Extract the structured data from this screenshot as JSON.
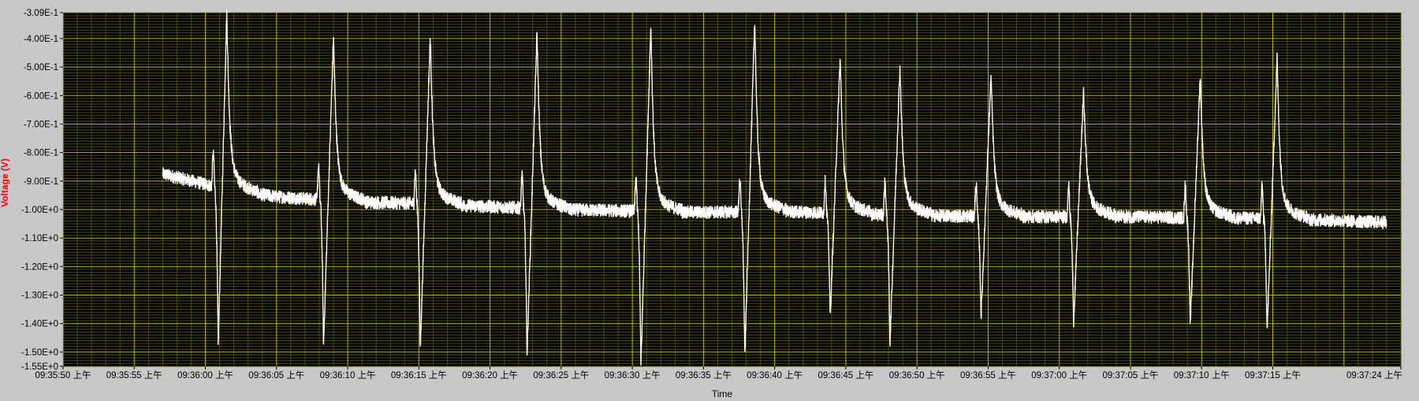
{
  "chart_data": {
    "type": "line",
    "title": "",
    "xlabel": "Time",
    "ylabel": "Voltage (V)",
    "y_scale": "linear",
    "ylim": [
      -1.55,
      -0.309
    ],
    "x_range": [
      "09:35:50",
      "09:37:24"
    ],
    "grid": true,
    "legend": "none",
    "colors": {
      "background": "#c8c8c8",
      "plot_background": "#000000",
      "grid_major": "#b8b800",
      "grid_minor": "#4a4a00",
      "trace": "#ffffff",
      "ylabel": "#ff0000",
      "tick_text": "#000000"
    },
    "y_ticks": [
      {
        "value": -0.309,
        "label": "-3.09E-1"
      },
      {
        "value": -0.4,
        "label": "-4.00E-1"
      },
      {
        "value": -0.5,
        "label": "-5.00E-1"
      },
      {
        "value": -0.6,
        "label": "-6.00E-1"
      },
      {
        "value": -0.7,
        "label": "-7.00E-1"
      },
      {
        "value": -0.8,
        "label": "-8.00E-1"
      },
      {
        "value": -0.9,
        "label": "-9.00E-1"
      },
      {
        "value": -1.0,
        "label": "-1.00E+0"
      },
      {
        "value": -1.1,
        "label": "-1.10E+0"
      },
      {
        "value": -1.2,
        "label": "-1.20E+0"
      },
      {
        "value": -1.3,
        "label": "-1.30E+0"
      },
      {
        "value": -1.4,
        "label": "-1.40E+0"
      },
      {
        "value": -1.5,
        "label": "-1.50E+0"
      },
      {
        "value": -1.55,
        "label": "-1.55E+0"
      }
    ],
    "x_ticks": [
      {
        "value": "09:35:50",
        "label": "09:35:50 上午"
      },
      {
        "value": "09:35:55",
        "label": "09:35:55 上午"
      },
      {
        "value": "09:36:00",
        "label": "09:36:00 上午"
      },
      {
        "value": "09:36:05",
        "label": "09:36:05 上午"
      },
      {
        "value": "09:36:10",
        "label": "09:36:10 上午"
      },
      {
        "value": "09:36:15",
        "label": "09:36:15 上午"
      },
      {
        "value": "09:36:20",
        "label": "09:36:20 上午"
      },
      {
        "value": "09:36:25",
        "label": "09:36:25 上午"
      },
      {
        "value": "09:36:30",
        "label": "09:36:30 上午"
      },
      {
        "value": "09:36:35",
        "label": "09:36:35 上午"
      },
      {
        "value": "09:36:40",
        "label": "09:36:40 上午"
      },
      {
        "value": "09:36:45",
        "label": "09:36:45 上午"
      },
      {
        "value": "09:36:50",
        "label": "09:36:50 上午"
      },
      {
        "value": "09:36:55",
        "label": "09:36:55 上午"
      },
      {
        "value": "09:37:00",
        "label": "09:37:00 上午"
      },
      {
        "value": "09:37:05",
        "label": "09:37:05 上午"
      },
      {
        "value": "09:37:10",
        "label": "09:37:10 上午"
      },
      {
        "value": "09:37:15",
        "label": "09:37:15 上午"
      },
      {
        "value": "09:37:24",
        "label": "09:37:24 上午"
      }
    ],
    "series": [
      {
        "start": "09:35:57.0",
        "end": "09:37:23.0",
        "baseline": [
          [
            "09:35:57.0",
            -0.875
          ],
          [
            "09:35:59.5",
            -0.905
          ],
          [
            "09:36:01.5",
            -0.93
          ],
          [
            "09:36:05.0",
            -0.955
          ],
          [
            "09:36:08.0",
            -0.965
          ],
          [
            "09:36:12.0",
            -0.975
          ],
          [
            "09:36:16.0",
            -0.98
          ],
          [
            "09:36:20.0",
            -0.99
          ],
          [
            "09:36:25.0",
            -1.0
          ],
          [
            "09:36:30.0",
            -1.005
          ],
          [
            "09:36:35.0",
            -1.01
          ],
          [
            "09:36:40.0",
            -1.005
          ],
          [
            "09:36:45.0",
            -1.015
          ],
          [
            "09:36:50.0",
            -1.02
          ],
          [
            "09:36:55.0",
            -1.025
          ],
          [
            "09:37:00.0",
            -1.025
          ],
          [
            "09:37:05.0",
            -1.025
          ],
          [
            "09:37:10.0",
            -1.03
          ],
          [
            "09:37:15.0",
            -1.03
          ],
          [
            "09:37:20.0",
            -1.04
          ],
          [
            "09:37:23.0",
            -1.045
          ]
        ],
        "beats": [
          {
            "trough_time": "09:36:00.9",
            "trough": -1.48,
            "peak_time": "09:36:01.5",
            "peak": -0.31
          },
          {
            "trough_time": "09:36:08.3",
            "trough": -1.48,
            "peak_time": "09:36:09.0",
            "peak": -0.39
          },
          {
            "trough_time": "09:36:15.1",
            "trough": -1.49,
            "peak_time": "09:36:15.8",
            "peak": -0.39
          },
          {
            "trough_time": "09:36:22.6",
            "trough": -1.51,
            "peak_time": "09:36:23.3",
            "peak": -0.38
          },
          {
            "trough_time": "09:36:30.6",
            "trough": -1.55,
            "peak_time": "09:36:31.3",
            "peak": -0.35
          },
          {
            "trough_time": "09:36:37.9",
            "trough": -1.52,
            "peak_time": "09:36:38.6",
            "peak": -0.33
          },
          {
            "trough_time": "09:36:43.9",
            "trough": -1.38,
            "peak_time": "09:36:44.6",
            "peak": -0.47
          },
          {
            "trough_time": "09:36:48.1",
            "trough": -1.47,
            "peak_time": "09:36:48.8",
            "peak": -0.5
          },
          {
            "trough_time": "09:36:54.5",
            "trough": -1.38,
            "peak_time": "09:36:55.2",
            "peak": -0.53
          },
          {
            "trough_time": "09:37:01.0",
            "trough": -1.4,
            "peak_time": "09:37:01.7",
            "peak": -0.59
          },
          {
            "trough_time": "09:37:09.2",
            "trough": -1.41,
            "peak_time": "09:37:09.9",
            "peak": -0.53
          },
          {
            "trough_time": "09:37:14.6",
            "trough": -1.43,
            "peak_time": "09:37:15.3",
            "peak": -0.47
          }
        ]
      }
    ]
  }
}
